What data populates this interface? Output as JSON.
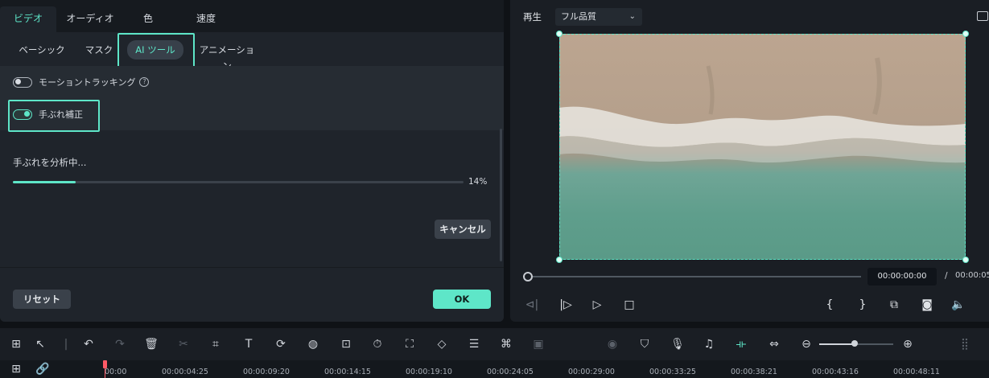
{
  "left_panel": {
    "main_tabs": [
      "ビデオ",
      "オーディオ",
      "色",
      "速度"
    ],
    "sub_tabs": [
      "ベーシック",
      "マスク",
      "AI ツール",
      "アニメーション"
    ],
    "motion_tracking": {
      "label": "モーショントラッキング",
      "help": "?",
      "enabled": false
    },
    "stabilization": {
      "label": "手ぶれ補正",
      "enabled": true
    },
    "analysis": {
      "label": "手ぶれを分析中...",
      "percent_text": "14%",
      "progress": 0.14
    },
    "buttons": {
      "cancel": "キャンセル",
      "reset": "リセット",
      "ok": "OK"
    }
  },
  "player": {
    "play_label": "再生",
    "quality": "フル品質",
    "current_time": "00:00:00:00",
    "separator": "/",
    "total_time": "00:00:05",
    "controls": {
      "prev_frame": "⊲|",
      "play_step": "|▷",
      "play": "▷",
      "stop": "□",
      "mark_in": "{",
      "mark_out": "}",
      "display": "⧉",
      "snapshot": "◙",
      "volume": "🔈"
    }
  },
  "timeline": {
    "ruler": [
      "00:00",
      "00:00:04:25",
      "00:00:09:20",
      "00:00:14:15",
      "00:00:19:10",
      "00:00:24:05",
      "00:00:29:00",
      "00:00:33:25",
      "00:00:38:21",
      "00:00:43:16",
      "00:00:48:11"
    ],
    "zoom_level": 0.48
  },
  "colors": {
    "accent": "#5ee6c8",
    "playhead": "#ff5a67",
    "panel": "#1f242b"
  }
}
